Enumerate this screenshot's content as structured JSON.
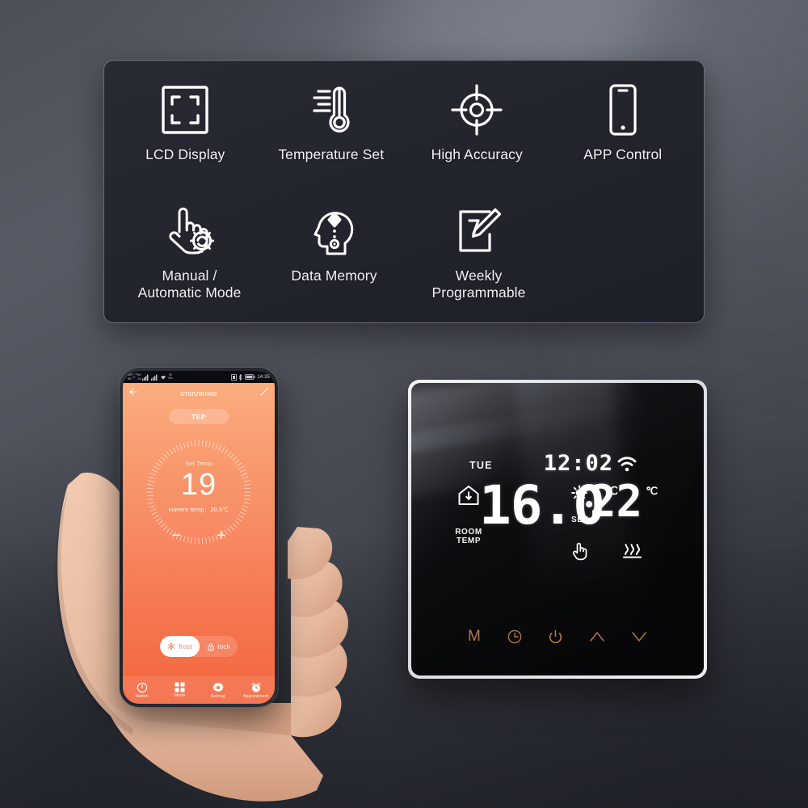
{
  "theme": {
    "panel_bg": "#23252e",
    "panel_border": "#c0c5d2",
    "icon_white": "#ffffff",
    "app_accent": "#f5845b",
    "app_gradient_top": "#fbb183",
    "app_gradient_bottom": "#f4663e",
    "lcd_white": "#ffffff",
    "thermostat_touch": "#b0764a",
    "bezel": "#e8ebee"
  },
  "feature_panel": {
    "features": [
      {
        "label": "LCD Display",
        "icon": "lcd-display-icon"
      },
      {
        "label": "Temperature Set",
        "icon": "thermometer-icon"
      },
      {
        "label": "High Accuracy",
        "icon": "crosshair-target-icon"
      },
      {
        "label": "APP Control",
        "icon": "smartphone-icon"
      },
      {
        "label": "Manual /\nAutomatic Mode",
        "icon": "hand-gear-icon"
      },
      {
        "label": "Data Memory",
        "icon": "head-memory-icon"
      },
      {
        "label": "Weekly\nProgrammable",
        "icon": "calendar-pencil-icon"
      }
    ]
  },
  "phone": {
    "statusbar": {
      "carrier_line1": "МегаФон",
      "carrier_line2": "МегаФон",
      "net_speed_line1": "92",
      "net_speed_line2": "B/s",
      "time": "14:35"
    },
    "appbar": {
      "title": "отопление",
      "back_icon": "arrow-left-icon",
      "edit_icon": "pencil-edit-icon"
    },
    "tep_button": "TEP",
    "dial": {
      "set_temp_label": "Set Temp",
      "set_temp_value": "19",
      "current_temp_label": "current temp：",
      "current_temp_value": "20.5℃",
      "minus": "−",
      "plus": "+"
    },
    "modes": [
      {
        "label": "frost",
        "icon": "snowflake-icon",
        "active": true
      },
      {
        "label": "lock",
        "icon": "padlock-icon",
        "active": false
      }
    ],
    "bottom_nav": [
      {
        "label": "Switch",
        "icon": "power-icon"
      },
      {
        "label": "Mode",
        "icon": "grid-squares-icon"
      },
      {
        "label": "Setting",
        "icon": "gear-icon"
      },
      {
        "label": "Appointment",
        "icon": "alarm-clock-icon"
      }
    ]
  },
  "thermostat": {
    "lcd": {
      "weekday": "TUE",
      "clock": "12:02",
      "wifi_icon": "wifi-icon",
      "room_temp_label": "ROOM\nTEMP",
      "room_temp_value": "16.0",
      "room_temp_unit": "℃",
      "house_icon": "house-temp-icon",
      "set_label": "SET",
      "set_value": "22",
      "set_unit": "℃",
      "auto_icon": "sun-auto-icon",
      "manual_icon": "hand-touch-icon",
      "heating_icon": "heating-waves-icon"
    },
    "touch_buttons": [
      {
        "label": "M",
        "icon": "mode-m-icon"
      },
      {
        "label": "",
        "icon": "clock-icon"
      },
      {
        "label": "",
        "icon": "power-icon"
      },
      {
        "label": "",
        "icon": "chevron-up-icon"
      },
      {
        "label": "",
        "icon": "chevron-down-icon"
      }
    ]
  }
}
